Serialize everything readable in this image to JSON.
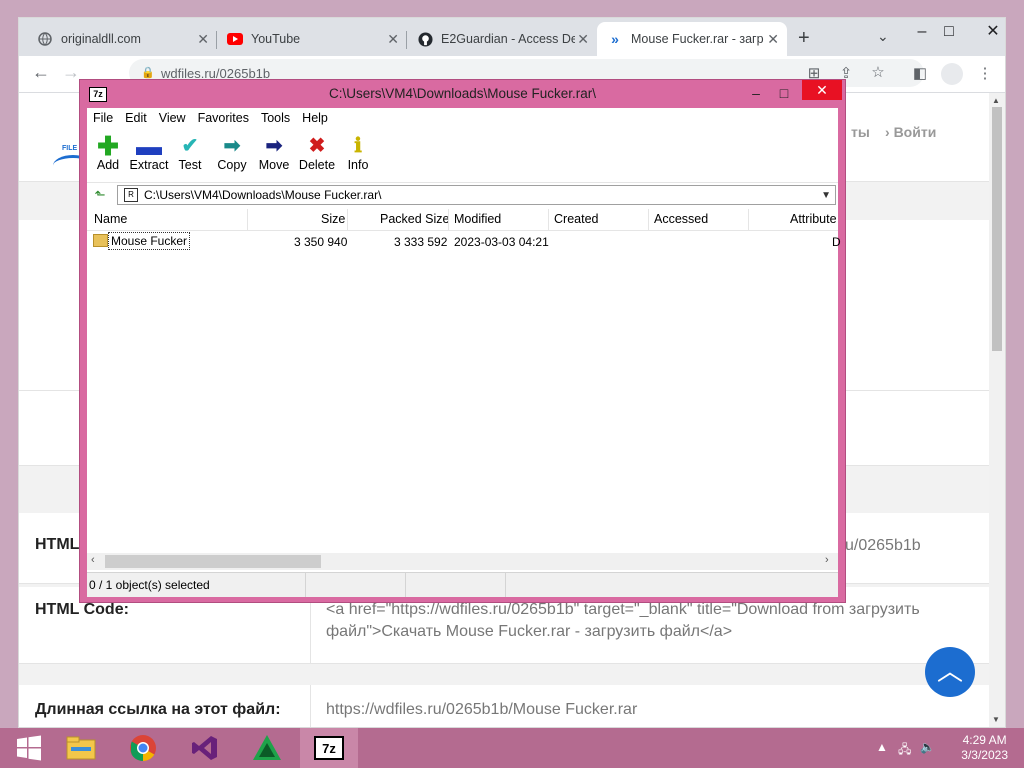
{
  "browser": {
    "tabs": [
      {
        "title": "originaldll.com",
        "icon": "globe-icon",
        "active": false
      },
      {
        "title": "YouTube",
        "icon": "youtube-icon",
        "active": false
      },
      {
        "title": "E2Guardian - Access De",
        "icon": "github-icon",
        "active": false
      },
      {
        "title": "Mouse Fucker.rar - загр",
        "icon": "wdfiles-icon",
        "active": true
      }
    ],
    "url": "wdfiles.ru/0265b1b"
  },
  "page": {
    "login_text": "Войти",
    "nav_fragment": "ты",
    "logo_fragment": "FILE",
    "html_label": "HTML",
    "html_value_fragment": "u/0265b1b",
    "html_code_label": "HTML Code:",
    "html_code_value": "<a href=\"https://wdfiles.ru/0265b1b\" target=\"_blank\" title=\"Download from загрузить файл\">Скачать Mouse Fucker.rar - загрузить файл</a>",
    "long_link_label": "Длинная ссылка на этот файл:",
    "long_link_value": "https://wdfiles.ru/0265b1b/Mouse Fucker.rar"
  },
  "archive_window": {
    "title": "C:\\Users\\VM4\\Downloads\\Mouse Fucker.rar\\",
    "app_icon_text": "7z",
    "menu": [
      "File",
      "Edit",
      "View",
      "Favorites",
      "Tools",
      "Help"
    ],
    "toolbar": [
      {
        "label": "Add",
        "icon": "add-icon",
        "color": "#22a822"
      },
      {
        "label": "Extract",
        "icon": "extract-icon",
        "color": "#1f3fbf"
      },
      {
        "label": "Test",
        "icon": "test-icon",
        "color": "#27b5b5"
      },
      {
        "label": "Copy",
        "icon": "copy-icon",
        "color": "#1a8a8a"
      },
      {
        "label": "Move",
        "icon": "move-icon",
        "color": "#1a237e"
      },
      {
        "label": "Delete",
        "icon": "delete-icon",
        "color": "#d01c1c"
      },
      {
        "label": "Info",
        "icon": "info-icon",
        "color": "#c9b400"
      }
    ],
    "address": "C:\\Users\\VM4\\Downloads\\Mouse Fucker.rar\\",
    "columns": [
      "Name",
      "Size",
      "Packed Size",
      "Modified",
      "Created",
      "Accessed",
      "Attribute"
    ],
    "rows": [
      {
        "name": "Mouse Fucker",
        "size": "3 350 940",
        "packed": "3 333 592",
        "modified": "2023-03-03 04:21",
        "created": "",
        "accessed": "",
        "attr": "D"
      }
    ],
    "status": "0 / 1 object(s) selected"
  },
  "taskbar": {
    "time": "4:29 AM",
    "date": "3/3/2023",
    "apps": [
      "file-explorer-icon",
      "chrome-icon",
      "visual-studio-icon",
      "app-green-icon",
      "7zip-icon"
    ]
  }
}
